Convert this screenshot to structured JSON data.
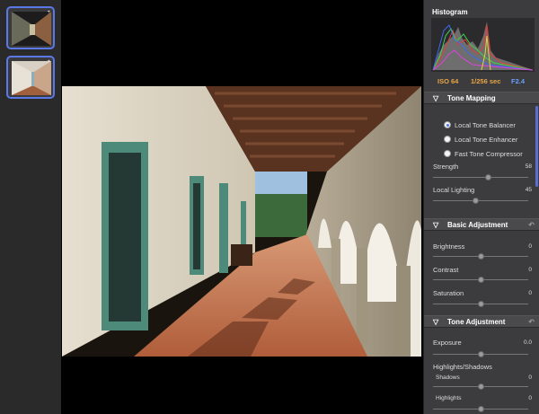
{
  "filmstrip": {
    "thumbs": [
      {
        "badge": "+"
      },
      {
        "badge": "+"
      }
    ]
  },
  "panel": {
    "histogram_title": "Histogram",
    "exif": {
      "iso": "ISO  64",
      "shutter": "1/256 sec",
      "aperture": "F2.4"
    },
    "tone_mapping": {
      "title": "Tone Mapping",
      "options": [
        {
          "label": "Local Tone Balancer",
          "selected": true
        },
        {
          "label": "Local Tone Enhancer",
          "selected": false
        },
        {
          "label": "Fast Tone Compressor",
          "selected": false
        }
      ],
      "strength": {
        "label": "Strength",
        "value": "58"
      },
      "local_lighting": {
        "label": "Local Lighting",
        "value": "45"
      }
    },
    "basic_adjustment": {
      "title": "Basic Adjustment",
      "brightness": {
        "label": "Brightness",
        "value": "0"
      },
      "contrast": {
        "label": "Contrast",
        "value": "0"
      },
      "saturation": {
        "label": "Saturation",
        "value": "0"
      }
    },
    "tone_adjustment": {
      "title": "Tone Adjustment",
      "exposure": {
        "label": "Exposure",
        "value": "0.0"
      },
      "highlights_shadows": {
        "label": "Highlights/Shadows"
      },
      "shadows": {
        "label": "Shadows",
        "value": "0"
      },
      "highlights": {
        "label": "Highlights",
        "value": "0"
      }
    },
    "icons": {
      "collapse": "triangle-down-icon",
      "reset": "reset-arrow-icon"
    },
    "colors": {
      "accent": "#5b78e8",
      "exif_orange": "#e8a545",
      "exif_blue": "#6aa0ff"
    }
  }
}
